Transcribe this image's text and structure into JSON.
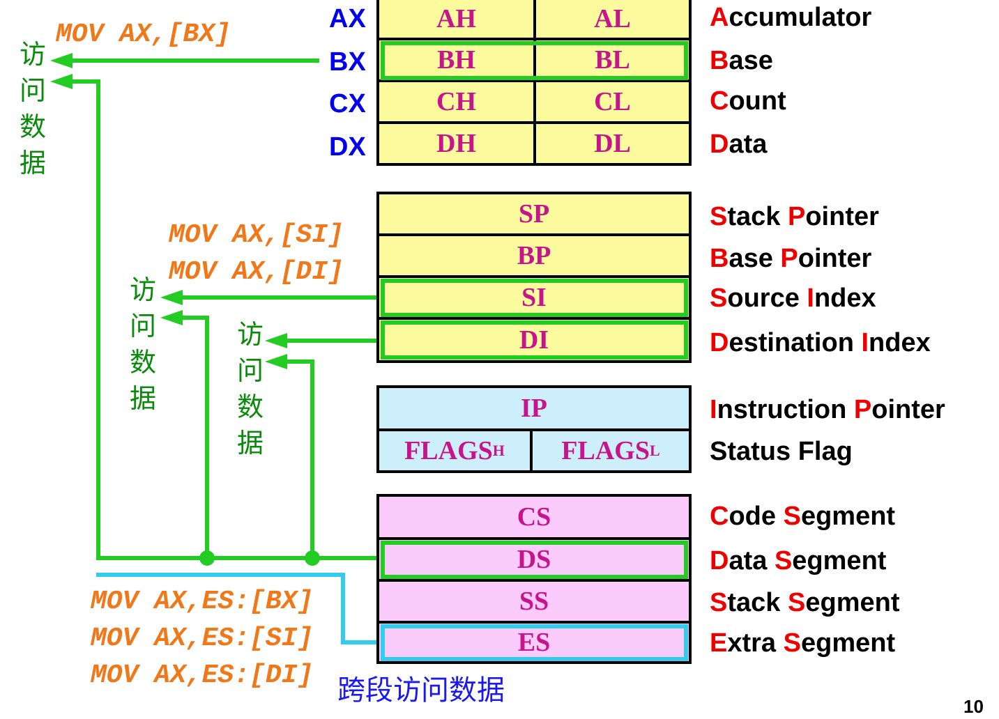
{
  "general_registers": [
    {
      "name": "AX",
      "high": "AH",
      "low": "AL",
      "first": "A",
      "rest": "ccumulator"
    },
    {
      "name": "BX",
      "high": "BH",
      "low": "BL",
      "first": "B",
      "rest": "ase"
    },
    {
      "name": "CX",
      "high": "CH",
      "low": "CL",
      "first": "C",
      "rest": "ount"
    },
    {
      "name": "DX",
      "high": "DH",
      "low": "DL",
      "first": "D",
      "rest": "ata"
    }
  ],
  "pointer_registers": [
    {
      "label": "SP",
      "w1k": "S",
      "w1": "tack ",
      "w2k": "P",
      "w2": "ointer"
    },
    {
      "label": "BP",
      "w1k": "B",
      "w1": "ase ",
      "w2k": "P",
      "w2": "ointer"
    },
    {
      "label": "SI",
      "w1k": "S",
      "w1": "ource ",
      "w2k": "I",
      "w2": "ndex"
    },
    {
      "label": "DI",
      "w1k": "D",
      "w1": "estination ",
      "w2k": "I",
      "w2": "ndex"
    }
  ],
  "control_registers": {
    "ip": {
      "label": "IP",
      "w1k": "I",
      "w1": "nstruction ",
      "w2k": "P",
      "w2": "ointer"
    },
    "flags_high": {
      "base": "FLAGS",
      "sub": "H"
    },
    "flags_low": {
      "base": "FLAGS",
      "sub": "L"
    },
    "flags_desc": "Status Flag"
  },
  "segment_registers": [
    {
      "label": "CS",
      "w1k": "C",
      "w1": "ode ",
      "w2k": "S",
      "w2": "egment"
    },
    {
      "label": "DS",
      "w1k": "D",
      "w1": "ata ",
      "w2k": "S",
      "w2": "egment"
    },
    {
      "label": "SS",
      "w1k": "S",
      "w1": "tack ",
      "w2k": "S",
      "w2": "egment"
    },
    {
      "label": "ES",
      "w1k": "E",
      "w1": "xtra ",
      "w2k": "S",
      "w2": "egment"
    }
  ],
  "code": {
    "bx": "MOV AX,[BX]",
    "si": "MOV AX,[SI]",
    "di": "MOV AX,[DI]",
    "es_bx": "MOV AX,ES:[BX]",
    "es_si": "MOV AX,ES:[SI]",
    "es_di": "MOV AX,ES:[DI]"
  },
  "access_label": [
    "访",
    "问",
    "数",
    "据"
  ],
  "cross_segment_label": "跨段访问数据",
  "page_number": "10",
  "colors": {
    "general_fill": "#fbfb9e",
    "control_fill": "#cdeefb",
    "segment_fill": "#fbcbfb",
    "register_text": "#c8148c",
    "register_name": "#0000ee",
    "description_key_letter": "#ee0000",
    "code_text": "#f07818",
    "access_arrow": "#22cc22",
    "cross_segment_arrow": "#33ccee",
    "access_label": "#0a8a0a",
    "cross_segment_label": "#1a1aee"
  }
}
